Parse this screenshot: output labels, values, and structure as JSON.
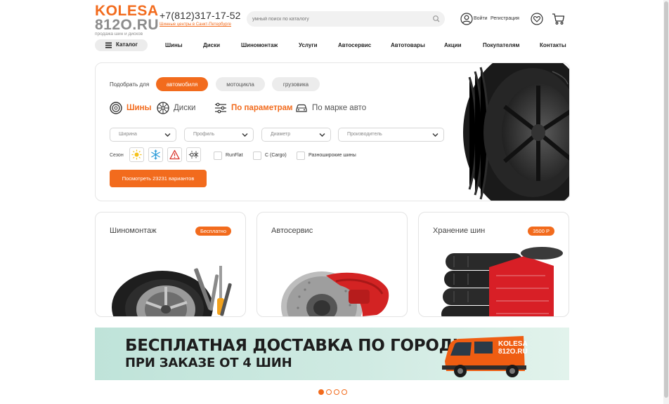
{
  "header": {
    "logo_line1": "KOLESA",
    "logo_line2": "812O.RU",
    "logo_tagline": "продажа шин и дисков",
    "phone": "+7(812)317-17-52",
    "phone_subtitle": "Шинные центры в Санкт-Петербурге",
    "search_placeholder": "умный поиск по каталогу",
    "login": "Войти",
    "register": "Регистрация"
  },
  "nav": {
    "catalog": "Каталог",
    "items": [
      "Шины",
      "Диски",
      "Шиномонтаж",
      "Услуги",
      "Автосервис",
      "Автотовары",
      "Акции",
      "Покупателям",
      "Контакты"
    ]
  },
  "selector": {
    "pick_for": "Подобрать для",
    "vehicle_tabs": [
      "автомобиля",
      "мотоцикла",
      "грузовика"
    ],
    "product_tabs": [
      "Шины",
      "Диски"
    ],
    "mode_tabs": [
      "По параметрам",
      "По марке авто"
    ],
    "filters": [
      "Ширина",
      "Профиль",
      "Диаметр",
      "Производитель"
    ],
    "season_label": "Сезон",
    "season_icons": [
      "sun-icon",
      "snowflake-icon",
      "warning-triangle-icon",
      "all-season-icon"
    ],
    "checkboxes": [
      "RunFlat",
      "C (Cargo)",
      "Разноширокие шины"
    ],
    "show_button": "Посмотреть 23231 вариантов"
  },
  "cards": [
    {
      "title": "Шиномонтаж",
      "badge": "Бесплатно"
    },
    {
      "title": "Автосервис",
      "badge": ""
    },
    {
      "title": "Хранение шин",
      "badge": "3500 Р"
    }
  ],
  "banner": {
    "line1": "БЕСПЛАТНАЯ ДОСТАВКА ПО ГОРОДУ",
    "line2": "ПРИ ЗАКАЗЕ ОТ 4 ШИН",
    "van_logo1": "KOLESA",
    "van_logo2": "812O.RU"
  },
  "slider": {
    "count": 4,
    "active": 1
  },
  "colors": {
    "accent": "#f26b1d",
    "gray_text": "#8c8c8c"
  }
}
